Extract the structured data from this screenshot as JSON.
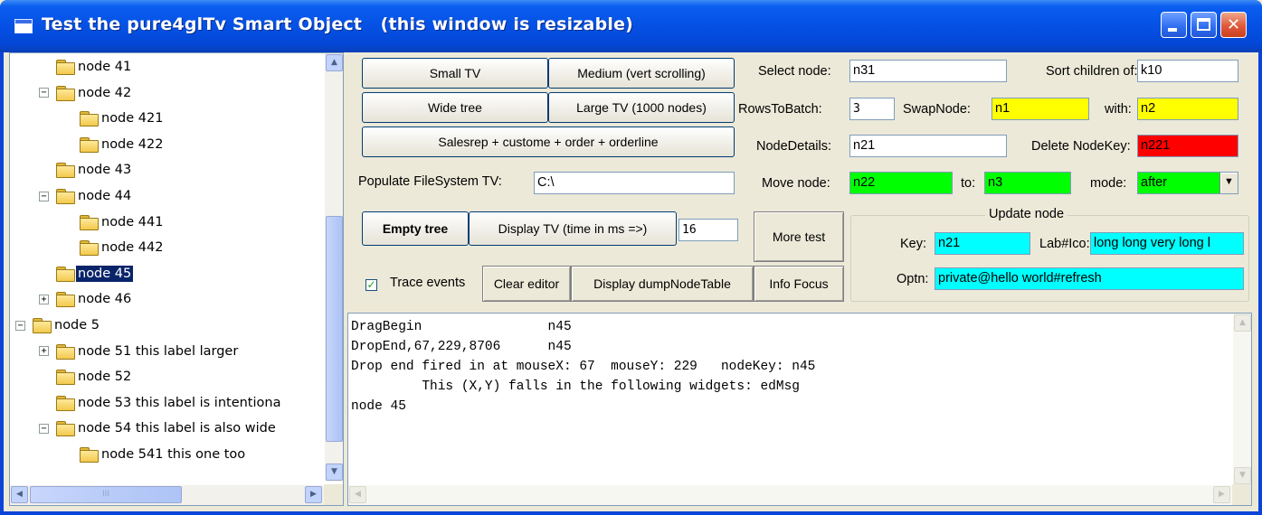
{
  "window": {
    "title": "Test the pure4glTv Smart Object   (this window is resizable)"
  },
  "tree": {
    "rows": [
      {
        "label": "node 41",
        "indent": 1,
        "expander": ""
      },
      {
        "label": "node 42",
        "indent": 1,
        "expander": "−"
      },
      {
        "label": "node 421",
        "indent": 2,
        "expander": ""
      },
      {
        "label": "node 422",
        "indent": 2,
        "expander": ""
      },
      {
        "label": "node 43",
        "indent": 1,
        "expander": ""
      },
      {
        "label": "node 44",
        "indent": 1,
        "expander": "−"
      },
      {
        "label": "node 441",
        "indent": 2,
        "expander": ""
      },
      {
        "label": "node 442",
        "indent": 2,
        "expander": ""
      },
      {
        "label": "node 45",
        "indent": 1,
        "expander": "",
        "selected": true
      },
      {
        "label": "node 46",
        "indent": 1,
        "expander": "+"
      },
      {
        "label": "node 5",
        "indent": 0,
        "expander": "−"
      },
      {
        "label": "node 51   this label larger",
        "indent": 1,
        "expander": "+"
      },
      {
        "label": "node 52",
        "indent": 1,
        "expander": ""
      },
      {
        "label": "node 53   this label is intentiona",
        "indent": 1,
        "expander": ""
      },
      {
        "label": "node 54   this label is also wide",
        "indent": 1,
        "expander": "−"
      },
      {
        "label": "node 541   this one too",
        "indent": 2,
        "expander": ""
      }
    ],
    "hscroll_thumb": "III"
  },
  "buttons": {
    "small_tv": "Small TV",
    "medium_tv": "Medium (vert scrolling)",
    "wide_tree": "Wide tree",
    "large_tv": "Large TV (1000 nodes)",
    "salesrep": "Salesrep + custome + order + orderline",
    "empty_tree": "Empty tree",
    "display_tv": "Display TV  (time in ms =>)",
    "more_test": "More test",
    "clear_editor": "Clear editor",
    "dump_node_table": "Display dumpNodeTable",
    "info_focus": "Info Focus"
  },
  "fields": {
    "populate_label": "Populate FileSystem TV:",
    "populate_value": "C:\\",
    "time_ms_value": "16",
    "select_node_label": "Select node:",
    "select_node_value": "n31",
    "sort_children_label": "Sort children of:",
    "sort_children_value": "k10",
    "rows_to_batch_label": "RowsToBatch:",
    "rows_to_batch_value": "3",
    "swap_node_label": "SwapNode:",
    "swap_node_value": "n1",
    "with_label": "with:",
    "with_value": "n2",
    "node_details_label": "NodeDetails:",
    "node_details_value": "n21",
    "delete_key_label": "Delete NodeKey:",
    "delete_key_value": "n221",
    "move_node_label": "Move node:",
    "move_node_value": "n22",
    "to_label": "to:",
    "to_value": "n3",
    "mode_label": "mode:",
    "mode_value": "after",
    "trace_events_label": "Trace events",
    "trace_events_checked": "✓"
  },
  "update_node": {
    "title": "Update node",
    "key_label": "Key:",
    "key_value": "n21",
    "labico_label": "Lab#Ico:",
    "labico_value": "long long very long l",
    "optn_label": "Optn:",
    "optn_value": "private@hello world#refresh"
  },
  "editor": {
    "text": "DragBegin                n45\nDropEnd,67,229,8706      n45\nDrop end fired in at mouseX: 67  mouseY: 229   nodeKey: n45\n         This (X,Y) falls in the following widgets: edMsg\nnode 45"
  },
  "colors": {
    "yellow": "#ffff00",
    "red": "#ff0000",
    "green": "#00ff00",
    "cyan": "#00ffff",
    "selection": "#0a246a"
  }
}
